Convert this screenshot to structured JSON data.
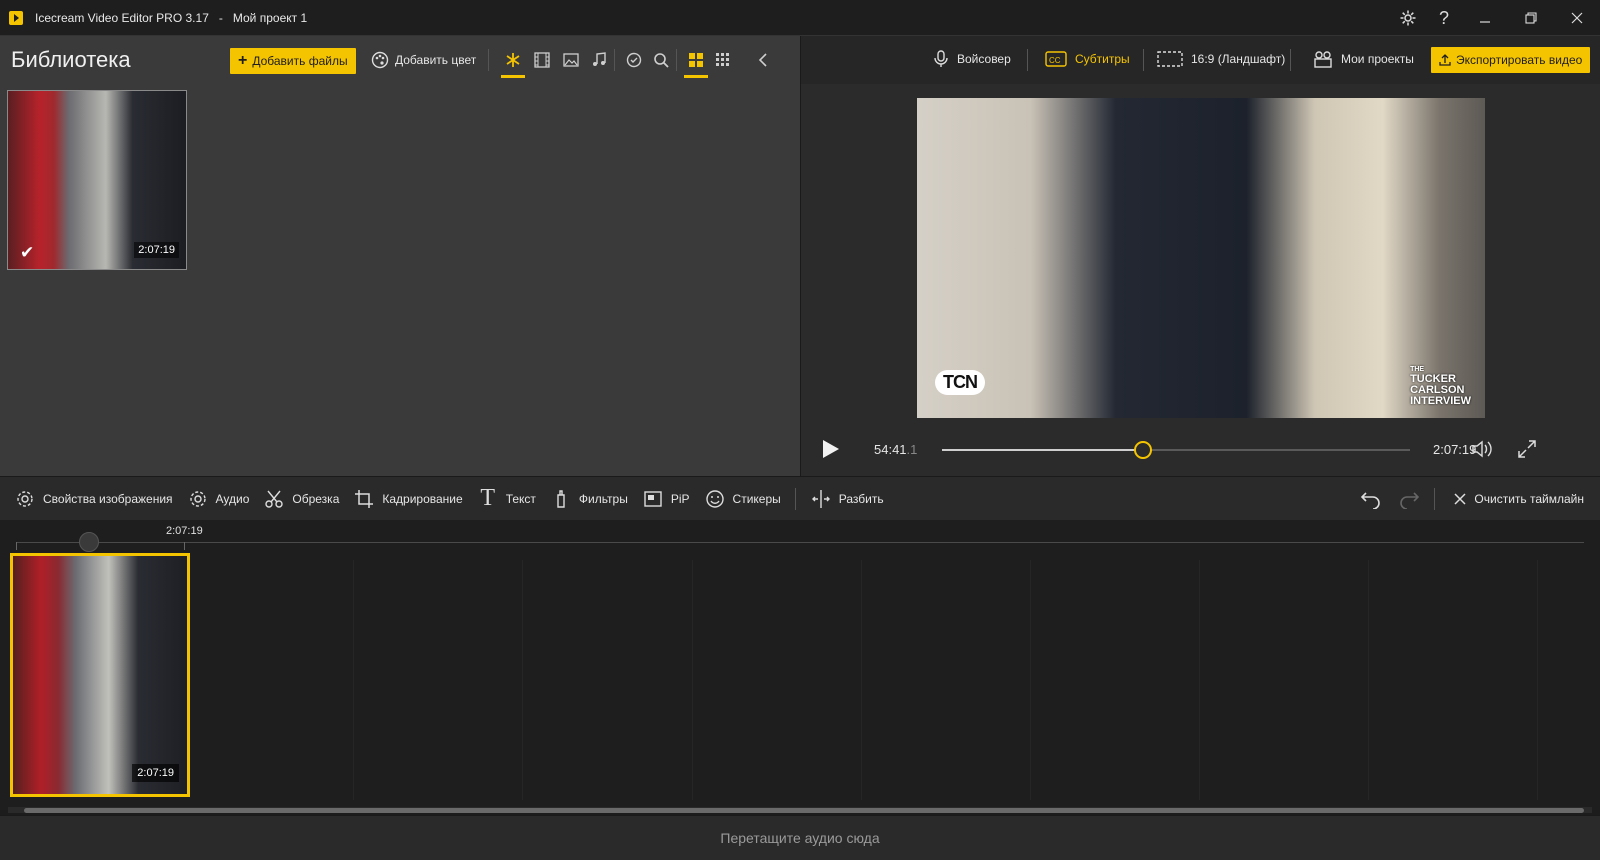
{
  "window": {
    "app_name": "Icecream Video Editor PRO 3.17",
    "separator": "-",
    "project_name": "Мой проект 1"
  },
  "library": {
    "title": "Библиотека",
    "add_files_label": "Добавить файлы",
    "add_color_label": "Добавить цвет",
    "items": [
      {
        "duration": "2:07:19",
        "selected": true
      }
    ]
  },
  "preview_header": {
    "voiceover_label": "Войсовер",
    "subtitles_label": "Субтитры",
    "aspect_label": "16:9 (Ландшафт)",
    "my_projects_label": "Мои проекты",
    "export_label": "Экспортировать видео"
  },
  "preview": {
    "overlay_logo": "TCN",
    "overlay_title_lines": [
      "THE",
      "TUCKER",
      "CARLSON",
      "INTERVIEW"
    ],
    "current_time": "54:41",
    "current_ms": ".1",
    "total_time": "2:07:19",
    "progress": 0.43
  },
  "edit_toolbar": {
    "image_properties": "Свойства изображения",
    "audio": "Аудио",
    "trim": "Обрезка",
    "crop": "Кадрирование",
    "text": "Текст",
    "filters": "Фильтры",
    "pip": "PiP",
    "stickers": "Стикеры",
    "split": "Разбить",
    "clear_timeline": "Очистить таймлайн"
  },
  "timeline": {
    "ruler_label": "2:07:19",
    "clip_duration": "2:07:19"
  },
  "audio_zone": {
    "hint": "Перетащите аудио сюда"
  },
  "colors": {
    "accent": "#f5c400",
    "background": "#1e1e1e",
    "panel": "#3a3a3a"
  }
}
